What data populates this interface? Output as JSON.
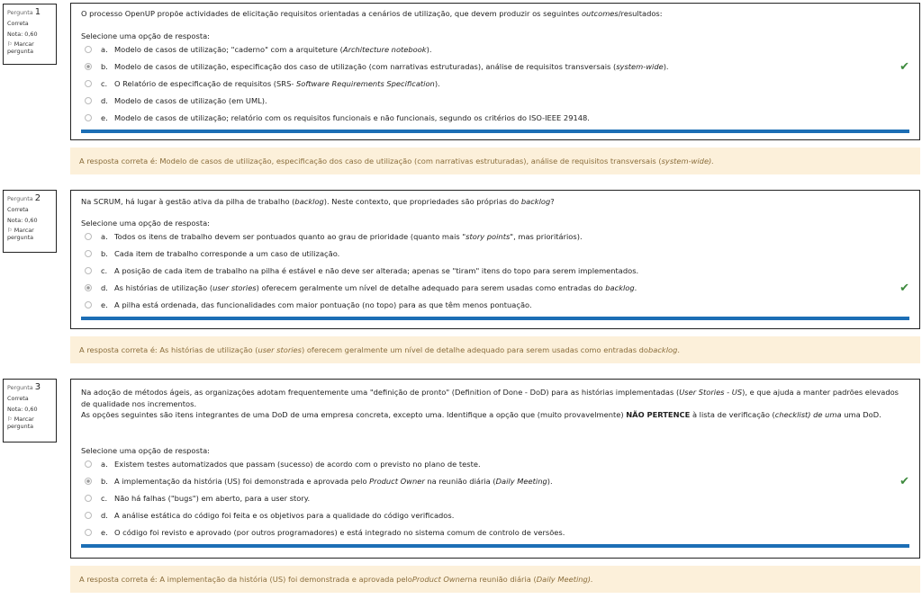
{
  "questions": [
    {
      "number": "1",
      "label": "Pergunta",
      "status": "Correta",
      "grade": "Nota: 0,60",
      "flag": "Marcar pergunta",
      "text_html": "O processo OpenUP propõe actividades de elicitação requisitos orientadas a cenários de utilização, que devem produzir os seguintes <i>outcomes</i>/resultados:",
      "prompt": "Selecione uma opção de resposta:",
      "options": [
        {
          "letter": "a.",
          "text_html": "Modelo de casos de utilização; \"caderno\" com a arquiteture (<i>Architecture notebook</i>).",
          "selected": false
        },
        {
          "letter": "b.",
          "text_html": "Modelo de casos de utilização, especificação dos caso de utilização (com narrativas estruturadas), análise de requisitos transversais (<i>system-wide</i>).",
          "selected": true
        },
        {
          "letter": "c.",
          "text_html": "O Relatório de especificação de requisitos (SRS- <i>Software Requirements Specification</i>).",
          "selected": false
        },
        {
          "letter": "d.",
          "text_html": "Modelo de casos de utilização (em UML).",
          "selected": false
        },
        {
          "letter": "e.",
          "text_html": "Modelo de casos de utilização; relatório com os requisitos funcionais e não funcionais, segundo os critérios do ISO-IEEE 29148.",
          "selected": false
        }
      ],
      "feedback_html": "A resposta correta é: Modelo de casos de utilização, especificação dos caso de utilização (com narrativas estruturadas), análise de requisitos transversais (<i>system-wide).</i>"
    },
    {
      "number": "2",
      "label": "Pergunta",
      "status": "Correta",
      "grade": "Nota: 0,60",
      "flag": "Marcar pergunta",
      "text_html": "Na SCRUM, há lugar à gestão ativa da pilha de trabalho (<i>backlog</i>). Neste contexto, que propriedades são próprias do <i>backlog</i>?",
      "prompt": "Selecione uma opção de resposta:",
      "options": [
        {
          "letter": "a.",
          "text_html": "Todos os itens de trabalho devem ser pontuados quanto ao grau de prioridade (quanto mais \"<i>story points</i>\", mas prioritários).",
          "selected": false
        },
        {
          "letter": "b.",
          "text_html": "Cada item de trabalho corresponde a um caso de utilização.",
          "selected": false
        },
        {
          "letter": "c.",
          "text_html": "A posição de cada item de trabalho na pilha é estável e não deve ser alterada; apenas se \"tiram\" itens do topo para serem implementados.",
          "selected": false
        },
        {
          "letter": "d.",
          "text_html": "As histórias de utilização (<i>user stories</i>) oferecem geralmente um nível de detalhe adequado para serem usadas como entradas do <i>backlog</i>.",
          "selected": true
        },
        {
          "letter": "e.",
          "text_html": "A pilha está ordenada, das funcionalidades com maior pontuação (no topo) para as que têm menos pontuação.",
          "selected": false
        }
      ],
      "feedback_html": "A resposta correta é: As histórias de utilização (<i>user stories</i>) oferecem geralmente um nível de detalhe adequado para serem usadas como entradas do <i>backlog</i>."
    },
    {
      "number": "3",
      "label": "Pergunta",
      "status": "Correta",
      "grade": "Nota: 0,60",
      "flag": "Marcar pergunta",
      "text_html": "Na adoção de métodos ágeis, as organizações adotam frequentemente uma \"definição de pronto\" (Definition of Done - DoD) para as histórias implementadas (<i>User Stories - US</i>), e que ajuda a manter padrões elevados de qualidade nos incrementos.<br>As opções seguintes são itens integrantes de uma DoD de uma empresa concreta, excepto uma. Identifique a opção que (muito provavelmente) <b>NÃO PERTENCE</b> à lista de verificação (<i>checklist) de uma</i> uma DoD.",
      "prompt": "Selecione uma opção de resposta:",
      "options": [
        {
          "letter": "a.",
          "text_html": "Existem testes automatizados que passam (sucesso) de acordo com o previsto no plano de teste.",
          "selected": false
        },
        {
          "letter": "b.",
          "text_html": "A implementação da história (US) foi demonstrada e aprovada pelo <i>Product Owner</i> na reunião diária (<i>Daily Meeting</i>).",
          "selected": true
        },
        {
          "letter": "c.",
          "text_html": "Não há falhas (\"bugs\") em aberto, para a user story.",
          "selected": false
        },
        {
          "letter": "d.",
          "text_html": "A análise estática do código foi feita e os objetivos para a qualidade do código verificados.",
          "selected": false
        },
        {
          "letter": "e.",
          "text_html": "O código foi revisto e aprovado (por outros programadores) e está integrado no sistema comum de controlo de versões.",
          "selected": false
        }
      ],
      "feedback_html": "A resposta correta é: A implementação da história (US) foi demonstrada e aprovada pelo <i>Product Owner</i> na reunião diária (<i>Daily Meeting).</i>"
    }
  ]
}
